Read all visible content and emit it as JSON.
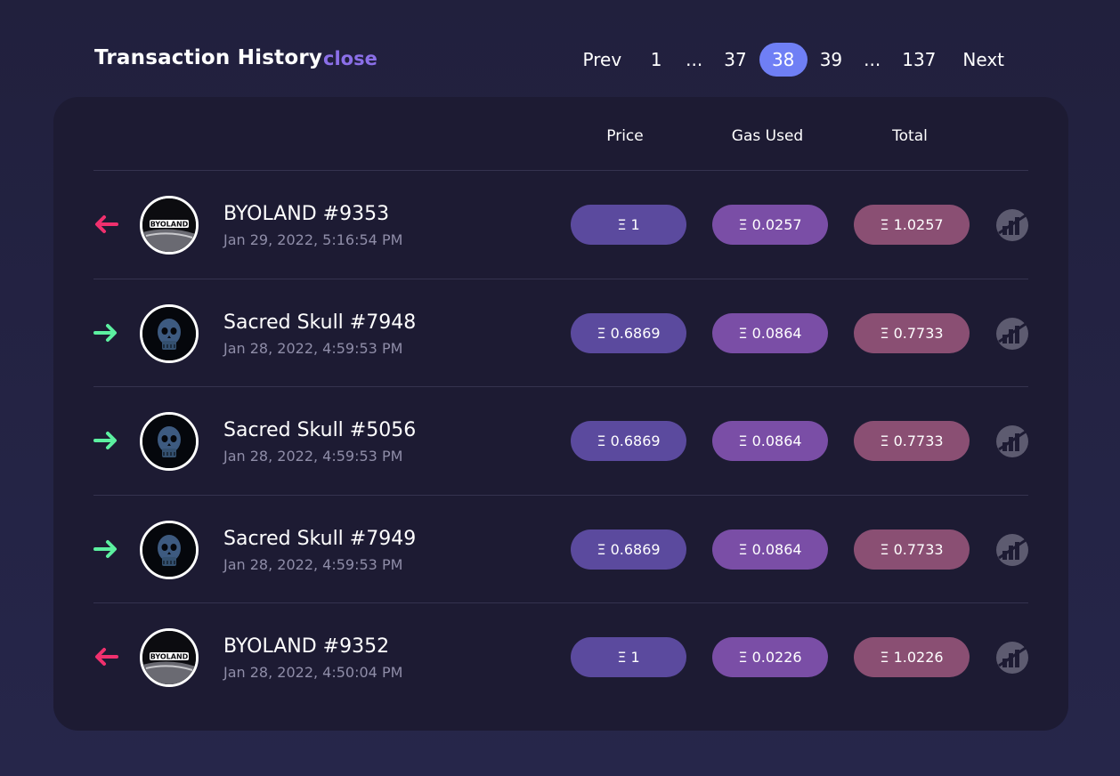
{
  "header": {
    "title": "Transaction History",
    "close_label": "close"
  },
  "pagination": {
    "prev_label": "Prev",
    "next_label": "Next",
    "pages": [
      "1",
      "...",
      "37",
      "38",
      "39",
      "...",
      "137"
    ],
    "current_page": "38"
  },
  "table": {
    "columns": [
      "Price",
      "Gas Used",
      "Total"
    ],
    "rows": [
      {
        "direction": "out",
        "avatar": "byoland-logo",
        "name": "BYOLAND #9353",
        "date": "Jan 29, 2022, 5:16:54 PM",
        "price": "Ξ 1",
        "gas": "Ξ 0.0257",
        "total": "Ξ 1.0257"
      },
      {
        "direction": "in",
        "avatar": "sacred-skull-image",
        "name": "Sacred Skull #7948",
        "date": "Jan 28, 2022, 4:59:53 PM",
        "price": "Ξ 0.6869",
        "gas": "Ξ 0.0864",
        "total": "Ξ 0.7733"
      },
      {
        "direction": "in",
        "avatar": "sacred-skull-image",
        "name": "Sacred Skull #5056",
        "date": "Jan 28, 2022, 4:59:53 PM",
        "price": "Ξ 0.6869",
        "gas": "Ξ 0.0864",
        "total": "Ξ 0.7733"
      },
      {
        "direction": "in",
        "avatar": "sacred-skull-image",
        "name": "Sacred Skull #7949",
        "date": "Jan 28, 2022, 4:59:53 PM",
        "price": "Ξ 0.6869",
        "gas": "Ξ 0.0864",
        "total": "Ξ 0.7733"
      },
      {
        "direction": "out",
        "avatar": "byoland-logo",
        "name": "BYOLAND #9352",
        "date": "Jan 28, 2022, 4:50:04 PM",
        "price": "Ξ 1",
        "gas": "Ξ 0.0226",
        "total": "Ξ 1.0226"
      }
    ]
  },
  "colors": {
    "background": "#21203d",
    "panel": "#1d1b33",
    "accent": "#6f7ff5",
    "close_link": "#8b6fe8",
    "arrow_out": "#f0306e",
    "arrow_in": "#5cf0a0",
    "price_pill": "#5b4a9e",
    "gas_pill": "#7a4ea6",
    "total_pill": "#8a4f73"
  },
  "icons": {
    "arrow_out": "arrow-left-icon",
    "arrow_in": "arrow-right-icon",
    "row_action": "chart-icon"
  }
}
